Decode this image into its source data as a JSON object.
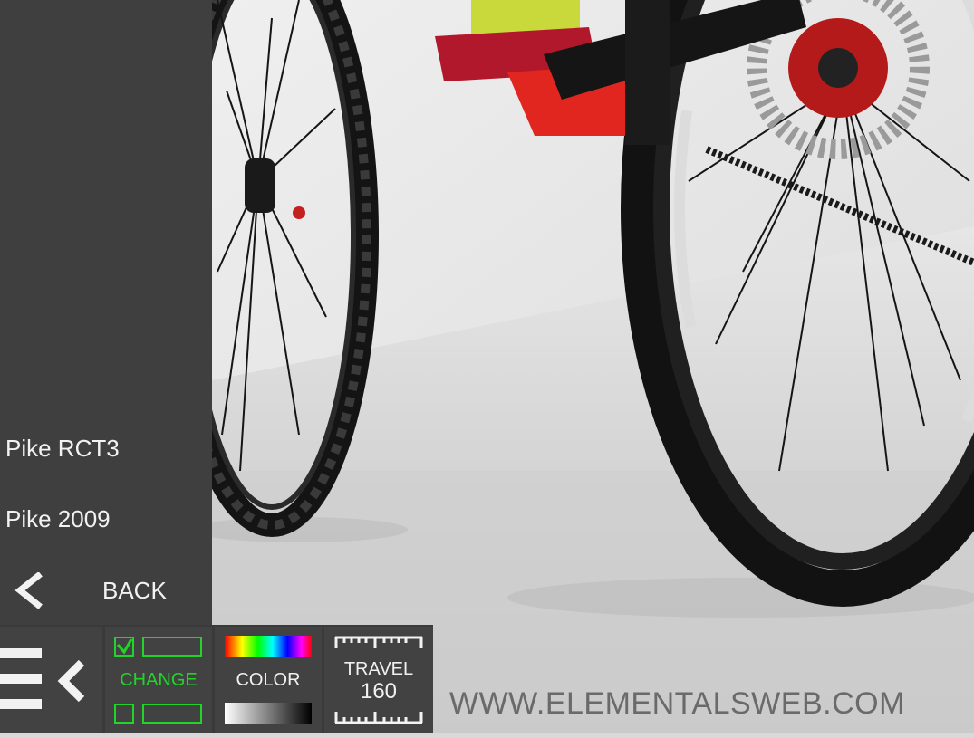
{
  "scene": {
    "description_icon": "bike-wheels-3d-render"
  },
  "menu": {
    "items": [
      {
        "label": "Pike RCT3"
      },
      {
        "label": "Pike 2009"
      }
    ],
    "back_label": "BACK"
  },
  "toolbar": {
    "change_label": "CHANGE",
    "color_label": "COLOR",
    "travel_label": "TRAVEL",
    "travel_value": "160"
  },
  "footer": {
    "website": "WWW.ELEMENTALSWEB.COM"
  },
  "colors": {
    "panel": "#3f3f3f",
    "toolbar": "#424242",
    "accent_green": "#22d42a",
    "text_light": "#f2f2f2"
  }
}
